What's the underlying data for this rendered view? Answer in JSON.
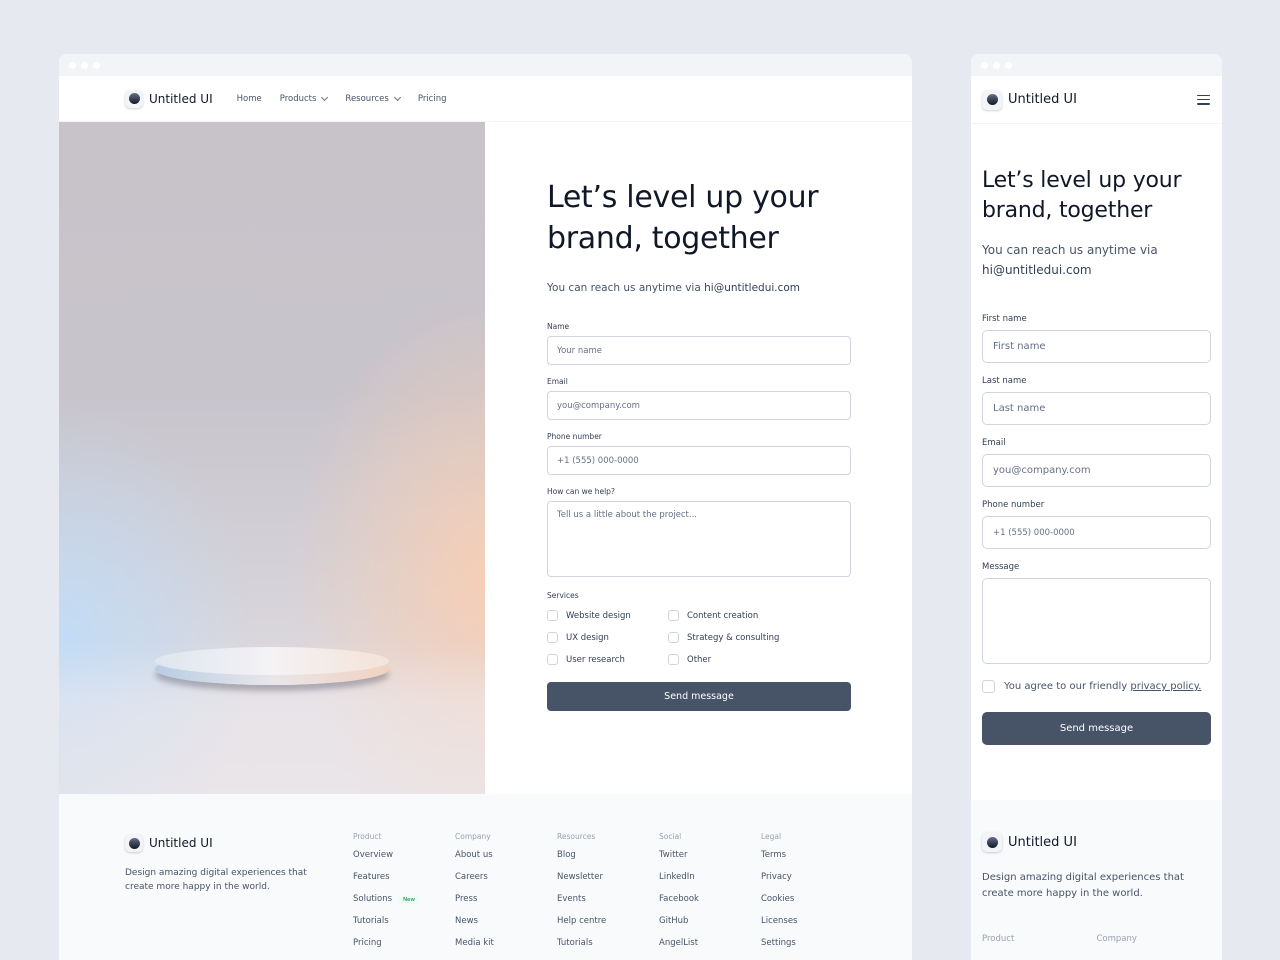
{
  "brand": {
    "name": "Untitled UI"
  },
  "desktop": {
    "nav": [
      {
        "label": "Home",
        "dropdown": false
      },
      {
        "label": "Products",
        "dropdown": true
      },
      {
        "label": "Resources",
        "dropdown": true
      },
      {
        "label": "Pricing",
        "dropdown": false
      }
    ],
    "heading": "Let’s level up your brand, together",
    "subtitle_prefix": "You can reach us anytime via ",
    "email": "hi@untitledui.com",
    "fields": {
      "name": {
        "label": "Name",
        "placeholder": "Your name"
      },
      "email": {
        "label": "Email",
        "placeholder": "you@company.com"
      },
      "phone": {
        "label": "Phone number",
        "placeholder": "+1 (555) 000-0000"
      },
      "help": {
        "label": "How can we help?",
        "placeholder": "Tell us a little about the project..."
      }
    },
    "services_label": "Services",
    "services": [
      "Website design",
      "Content creation",
      "UX design",
      "Strategy & consulting",
      "User research",
      "Other"
    ],
    "submit": "Send message"
  },
  "footer": {
    "description": "Design amazing digital experiences that create more happy in the world.",
    "columns": [
      {
        "title": "Product",
        "items": [
          {
            "label": "Overview"
          },
          {
            "label": "Features"
          },
          {
            "label": "Solutions",
            "badge": "New"
          },
          {
            "label": "Tutorials"
          },
          {
            "label": "Pricing"
          }
        ]
      },
      {
        "title": "Company",
        "items": [
          {
            "label": "About us"
          },
          {
            "label": "Careers"
          },
          {
            "label": "Press"
          },
          {
            "label": "News"
          },
          {
            "label": "Media kit"
          }
        ]
      },
      {
        "title": "Resources",
        "items": [
          {
            "label": "Blog"
          },
          {
            "label": "Newsletter"
          },
          {
            "label": "Events"
          },
          {
            "label": "Help centre"
          },
          {
            "label": "Tutorials"
          }
        ]
      },
      {
        "title": "Social",
        "items": [
          {
            "label": "Twitter"
          },
          {
            "label": "LinkedIn"
          },
          {
            "label": "Facebook"
          },
          {
            "label": "GitHub"
          },
          {
            "label": "AngelList"
          }
        ]
      },
      {
        "title": "Legal",
        "items": [
          {
            "label": "Terms"
          },
          {
            "label": "Privacy"
          },
          {
            "label": "Cookies"
          },
          {
            "label": "Licenses"
          },
          {
            "label": "Settings"
          }
        ]
      }
    ]
  },
  "mobile": {
    "heading": "Let’s level up your brand, together",
    "subtitle_prefix": "You can reach us anytime via",
    "email": "hi@untitledui.com",
    "fields": {
      "first": {
        "label": "First name",
        "placeholder": "First name"
      },
      "last": {
        "label": "Last name",
        "placeholder": "Last name"
      },
      "email": {
        "label": "Email",
        "placeholder": "you@company.com"
      },
      "phone": {
        "label": "Phone number",
        "placeholder": "+1 (555) 000-0000"
      },
      "message": {
        "label": "Message",
        "placeholder": ""
      }
    },
    "agree_prefix": "You agree to our friendly ",
    "agree_link": "privacy policy.",
    "submit": "Send message",
    "footer_heads": [
      "Product",
      "Company"
    ]
  },
  "colors": {
    "button": "#475467",
    "page_bg": "#e6e9f0",
    "footer_bg": "#f9fafb"
  }
}
